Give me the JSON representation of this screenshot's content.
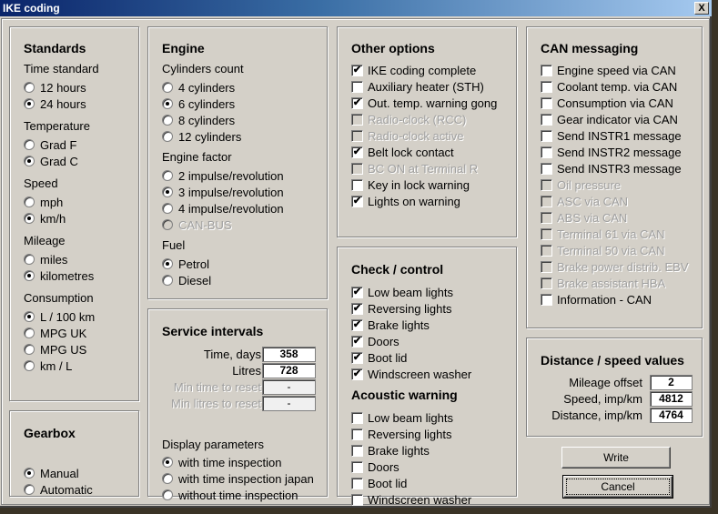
{
  "window": {
    "title": "IKE coding",
    "close_label": "X"
  },
  "standards": {
    "title": "Standards",
    "groups": [
      {
        "label": "Time standard",
        "options": [
          {
            "label": "12 hours",
            "selected": false
          },
          {
            "label": "24 hours",
            "selected": true
          }
        ]
      },
      {
        "label": "Temperature",
        "options": [
          {
            "label": "Grad F",
            "selected": false
          },
          {
            "label": "Grad C",
            "selected": true
          }
        ]
      },
      {
        "label": "Speed",
        "options": [
          {
            "label": "mph",
            "selected": false
          },
          {
            "label": "km/h",
            "selected": true
          }
        ]
      },
      {
        "label": "Mileage",
        "options": [
          {
            "label": "miles",
            "selected": false
          },
          {
            "label": "kilometres",
            "selected": true
          }
        ]
      },
      {
        "label": "Consumption",
        "options": [
          {
            "label": "L / 100 km",
            "selected": true
          },
          {
            "label": "MPG UK",
            "selected": false
          },
          {
            "label": "MPG US",
            "selected": false
          },
          {
            "label": "km / L",
            "selected": false
          }
        ]
      }
    ]
  },
  "gearbox": {
    "title": "Gearbox",
    "options": [
      {
        "label": "Manual",
        "selected": true
      },
      {
        "label": "Automatic",
        "selected": false
      }
    ]
  },
  "engine": {
    "title": "Engine",
    "cylinders": {
      "label": "Cylinders count",
      "options": [
        {
          "label": "4 cylinders",
          "selected": false
        },
        {
          "label": "6 cylinders",
          "selected": true
        },
        {
          "label": "8 cylinders",
          "selected": false
        },
        {
          "label": "12 cylinders",
          "selected": false
        }
      ]
    },
    "factor": {
      "label": "Engine factor",
      "options": [
        {
          "label": "2 impulse/revolution",
          "selected": false
        },
        {
          "label": "3 impulse/revolution",
          "selected": true
        },
        {
          "label": "4 impulse/revolution",
          "selected": false
        },
        {
          "label": "CAN-BUS",
          "selected": false,
          "disabled": true
        }
      ]
    },
    "fuel": {
      "label": "Fuel",
      "options": [
        {
          "label": "Petrol",
          "selected": true
        },
        {
          "label": "Diesel",
          "selected": false
        }
      ]
    }
  },
  "service": {
    "title": "Service intervals",
    "fields": [
      {
        "label": "Time, days",
        "value": "358",
        "disabled": false
      },
      {
        "label": "Litres",
        "value": "728",
        "disabled": false
      },
      {
        "label": "Min time to reset",
        "value": "-",
        "disabled": true
      },
      {
        "label": "Min litres to reset",
        "value": "-",
        "disabled": true
      }
    ],
    "display_label": "Display parameters",
    "display_options": [
      {
        "label": "with time inspection",
        "selected": true
      },
      {
        "label": "with time inspection japan",
        "selected": false
      },
      {
        "label": "without time inspection",
        "selected": false
      }
    ]
  },
  "other": {
    "title": "Other options",
    "items": [
      {
        "label": "IKE coding complete",
        "checked": true,
        "disabled": false
      },
      {
        "label": "Auxiliary heater (STH)",
        "checked": false,
        "disabled": false
      },
      {
        "label": "Out. temp. warning gong",
        "checked": true,
        "disabled": false
      },
      {
        "label": "Radio-clock (RCC)",
        "checked": false,
        "disabled": true
      },
      {
        "label": "Radio-clock active",
        "checked": false,
        "disabled": true
      },
      {
        "label": "Belt lock contact",
        "checked": true,
        "disabled": false
      },
      {
        "label": "BC ON at Terminal R",
        "checked": false,
        "disabled": true
      },
      {
        "label": "Key in lock warning",
        "checked": false,
        "disabled": false
      },
      {
        "label": "Lights on warning",
        "checked": true,
        "disabled": false
      }
    ]
  },
  "check": {
    "title": "Check / control",
    "items": [
      {
        "label": "Low beam lights",
        "checked": true
      },
      {
        "label": "Reversing lights",
        "checked": true
      },
      {
        "label": "Brake lights",
        "checked": true
      },
      {
        "label": "Doors",
        "checked": true
      },
      {
        "label": "Boot lid",
        "checked": true
      },
      {
        "label": "Windscreen washer",
        "checked": true
      }
    ],
    "acoustic_title": "Acoustic warning",
    "acoustic_items": [
      {
        "label": "Low beam lights",
        "checked": false
      },
      {
        "label": "Reversing lights",
        "checked": false
      },
      {
        "label": "Brake lights",
        "checked": false
      },
      {
        "label": "Doors",
        "checked": false
      },
      {
        "label": "Boot lid",
        "checked": false
      },
      {
        "label": "Windscreen washer",
        "checked": false
      }
    ]
  },
  "can": {
    "title": "CAN messaging",
    "items": [
      {
        "label": "Engine speed via CAN",
        "checked": false,
        "disabled": false
      },
      {
        "label": "Coolant temp. via CAN",
        "checked": false,
        "disabled": false
      },
      {
        "label": "Consumption via CAN",
        "checked": false,
        "disabled": false
      },
      {
        "label": "Gear indicator via CAN",
        "checked": false,
        "disabled": false
      },
      {
        "label": "Send INSTR1 message",
        "checked": false,
        "disabled": false
      },
      {
        "label": "Send INSTR2 message",
        "checked": false,
        "disabled": false
      },
      {
        "label": "Send INSTR3 message",
        "checked": false,
        "disabled": false
      },
      {
        "label": "Oil pressure",
        "checked": false,
        "disabled": true
      },
      {
        "label": "ASC via CAN",
        "checked": false,
        "disabled": true
      },
      {
        "label": "ABS via CAN",
        "checked": false,
        "disabled": true
      },
      {
        "label": "Terminal 61 via CAN",
        "checked": false,
        "disabled": true
      },
      {
        "label": "Terminal 50 via CAN",
        "checked": false,
        "disabled": true
      },
      {
        "label": "Brake power distrib. EBV",
        "checked": false,
        "disabled": true
      },
      {
        "label": "Brake assistant HBA",
        "checked": false,
        "disabled": true
      },
      {
        "label": "Information - CAN",
        "checked": false,
        "disabled": false
      }
    ]
  },
  "distance": {
    "title": "Distance / speed values",
    "fields": [
      {
        "label": "Mileage offset",
        "value": "2"
      },
      {
        "label": "Speed, imp/km",
        "value": "4812"
      },
      {
        "label": "Distance, imp/km",
        "value": "4764"
      }
    ]
  },
  "buttons": {
    "write": "Write",
    "cancel": "Cancel"
  }
}
